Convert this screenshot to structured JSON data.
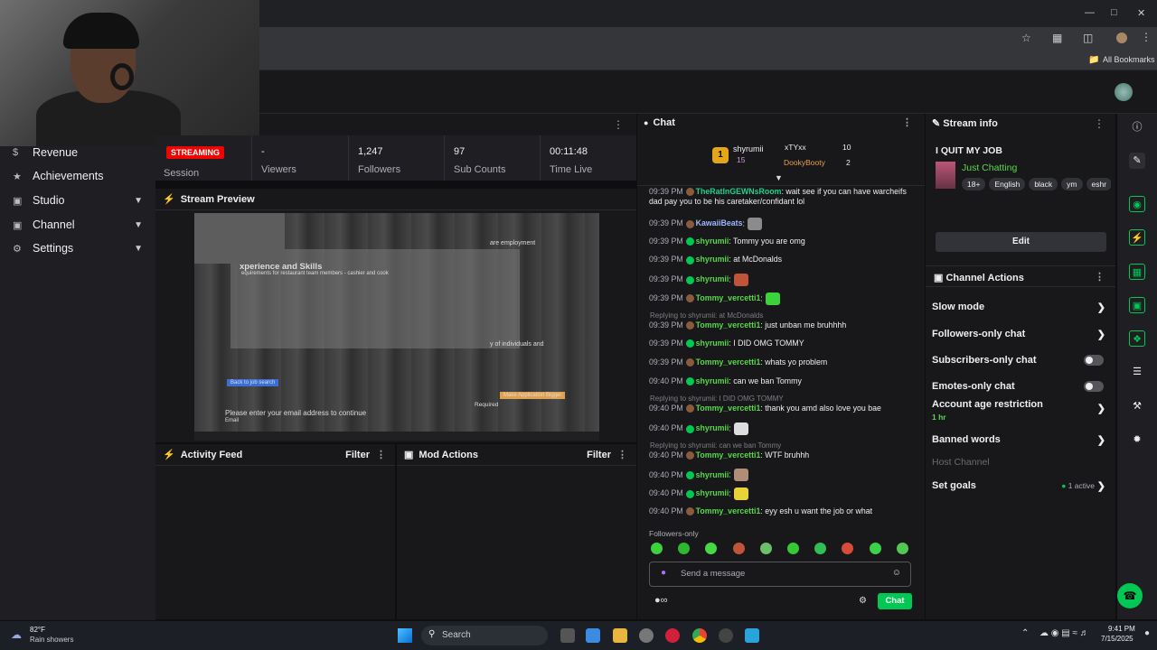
{
  "browser": {
    "bookmarks_label": "All Bookmarks"
  },
  "sidebar": {
    "items": [
      {
        "label": "Revenue",
        "icon": "dollar-icon",
        "has_chevron": false
      },
      {
        "label": "Achievements",
        "icon": "trophy-icon",
        "has_chevron": false
      },
      {
        "label": "Studio",
        "icon": "studio-icon",
        "has_chevron": true
      },
      {
        "label": "Channel",
        "icon": "channel-icon",
        "has_chevron": true
      },
      {
        "label": "Settings",
        "icon": "gear-icon",
        "has_chevron": true
      }
    ]
  },
  "stats": {
    "session_badge": "STREAMING",
    "session_label": "Session",
    "viewers_value": "-",
    "viewers_label": "Viewers",
    "followers_value": "1,247",
    "followers_label": "Followers",
    "subs_value": "97",
    "subs_label": "Sub Counts",
    "time_value": "00:11:48",
    "time_label": "Time Live"
  },
  "preview": {
    "title": "Stream Preview",
    "doc_heading": "xperience and Skills",
    "doc_sub": "equirements for restaurant team members - cashier and cook",
    "right_text": "are employment",
    "right_text2": "y of individuals and",
    "email_prompt": "Please enter your email address to continue",
    "email_label": "Email",
    "back_button": "Back to job search",
    "apply_button": "Make Application Bigger",
    "required": "Required"
  },
  "activity": {
    "title": "Activity Feed",
    "filter": "Filter"
  },
  "mod": {
    "title": "Mod Actions",
    "filter": "Filter"
  },
  "chat": {
    "title": "Chat",
    "leaderboard": {
      "first_user": "shyrumii",
      "first_count": "15",
      "second_user": "xTYxx",
      "second_count": "10",
      "third_user": "DookyBooty",
      "third_count": "2",
      "rank": "1"
    },
    "messages": [
      {
        "time": "09:39 PM",
        "user": "TheRatInGEWNsRoom",
        "text": ": wait see if you can have warcheifs dad pay you to be his caretaker/confidant lol",
        "color": "#1fd18a",
        "mod": false,
        "emote": ""
      },
      {
        "time": "09:39 PM",
        "user": "KawaiiBeats",
        "text": ":",
        "color": "#9fb6ff",
        "mod": false,
        "emote": "#8b8b8b"
      },
      {
        "time": "09:39 PM",
        "user": "shyrumii",
        "text": ": Tommy you are omg",
        "color": "#58d84a",
        "mod": true,
        "emote": ""
      },
      {
        "time": "09:39 PM",
        "user": "shyrumii",
        "text": ": at McDonalds",
        "color": "#58d84a",
        "mod": true,
        "emote": ""
      },
      {
        "time": "09:39 PM",
        "user": "shyrumii",
        "text": ":",
        "color": "#58d84a",
        "mod": true,
        "emote": "#c0543a"
      },
      {
        "time": "09:39 PM",
        "user": "Tommy_vercetti1",
        "text": ":",
        "color": "#58d84a",
        "mod": false,
        "emote": "#3bd23b"
      },
      {
        "time": "09:39 PM",
        "user": "Tommy_vercetti1",
        "text": ": just unban me bruhhhh",
        "color": "#58d84a",
        "mod": false,
        "emote": "",
        "reply": "Replying to shyrumii: at McDonalds"
      },
      {
        "time": "09:39 PM",
        "user": "shyrumii",
        "text": ": I DID OMG TOMMY",
        "color": "#58d84a",
        "mod": true,
        "emote": ""
      },
      {
        "time": "09:39 PM",
        "user": "Tommy_vercetti1",
        "text": ": whats yo problem",
        "color": "#58d84a",
        "mod": false,
        "emote": ""
      },
      {
        "time": "09:40 PM",
        "user": "shyrumii",
        "text": ": can we ban Tommy",
        "color": "#58d84a",
        "mod": true,
        "emote": ""
      },
      {
        "time": "09:40 PM",
        "user": "Tommy_vercetti1",
        "text": ": thank you amd also love you bae",
        "color": "#58d84a",
        "mod": false,
        "emote": "",
        "reply": "Replying to shyrumii: I DID OMG TOMMY"
      },
      {
        "time": "09:40 PM",
        "user": "shyrumii",
        "text": ":",
        "color": "#58d84a",
        "mod": true,
        "emote": "#dddddd"
      },
      {
        "time": "09:40 PM",
        "user": "Tommy_vercetti1",
        "text": ": WTF bruhhh",
        "color": "#58d84a",
        "mod": false,
        "emote": "",
        "reply": "Replying to shyrumii: can we ban Tommy"
      },
      {
        "time": "09:40 PM",
        "user": "shyrumii",
        "text": ":",
        "color": "#58d84a",
        "mod": true,
        "emote": "#b08d76"
      },
      {
        "time": "09:40 PM",
        "user": "shyrumii",
        "text": ":",
        "color": "#58d84a",
        "mod": true,
        "emote": "#e8d23a"
      },
      {
        "time": "09:40 PM",
        "user": "Tommy_vercetti1",
        "text": ": eyy esh u want the job or what",
        "color": "#58d84a",
        "mod": false,
        "emote": ""
      }
    ],
    "followers_only": "Followers-only",
    "input_placeholder": "Send a message",
    "chat_button": "Chat"
  },
  "stream_info": {
    "title": "Stream info",
    "stream_title": "I QUIT MY JOB",
    "category": "Just Chatting",
    "tags": [
      "18+",
      "English",
      "black",
      "ym",
      "eshr"
    ],
    "edit_button": "Edit"
  },
  "channel_actions": {
    "title": "Channel Actions",
    "items": [
      {
        "label": "Slow mode",
        "control": "chevron"
      },
      {
        "label": "Followers-only chat",
        "control": "chevron"
      },
      {
        "label": "Subscribers-only chat",
        "control": "toggle"
      },
      {
        "label": "Emotes-only chat",
        "control": "toggle"
      },
      {
        "label": "Account age restriction",
        "control": "chevron",
        "sub": "1 hr"
      },
      {
        "label": "Banned words",
        "control": "chevron"
      },
      {
        "label": "Host Channel",
        "control": "none"
      },
      {
        "label": "Set goals",
        "control": "chevron",
        "status": "1 active"
      }
    ]
  },
  "taskbar": {
    "weather_temp": "82°F",
    "weather_desc": "Rain showers",
    "search": "Search",
    "time": "9:41 PM",
    "date": "7/15/2025"
  },
  "colors": {
    "accent_green": "#00c853",
    "live_red": "#eb0400"
  }
}
